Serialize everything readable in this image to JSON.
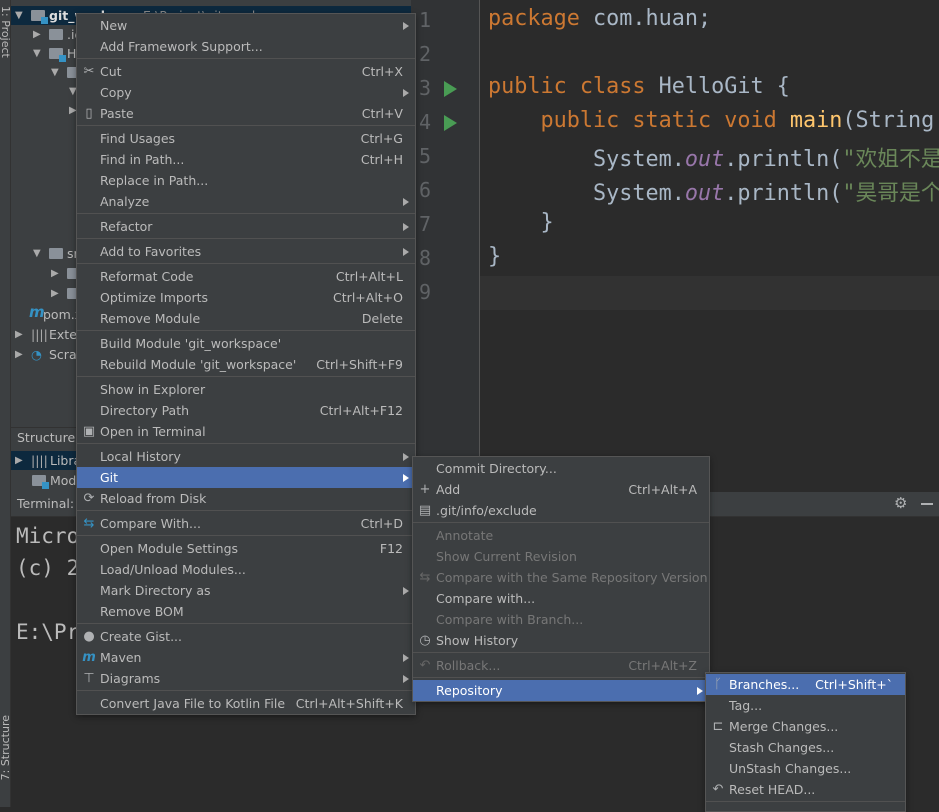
{
  "sidebar_tabs": {
    "project": "1: Project",
    "structure": "7: Structure"
  },
  "project_tree": [
    {
      "label": "git_workspace",
      "path": "E:\\Project\\git_workspace",
      "selected": true,
      "expanded": true,
      "icon": "module-folder-icon"
    },
    {
      "label": ".idea",
      "expanded": false,
      "icon": "folder-icon"
    },
    {
      "label": "HelloGit",
      "expanded": true,
      "icon": "module-folder-icon"
    },
    {
      "label": "",
      "expanded": true,
      "icon": "folder-icon"
    },
    {
      "label": "",
      "expanded": true,
      "icon": "none"
    },
    {
      "label": "",
      "expanded": false,
      "icon": "folder-icon"
    },
    {
      "label": "m",
      "expanded": null,
      "icon": "maven-icon"
    },
    {
      "label": "src",
      "expanded": true,
      "icon": "folder-icon"
    },
    {
      "label": "",
      "expanded": false,
      "icon": "folder-icon"
    },
    {
      "label": "",
      "expanded": false,
      "icon": "folder-icon"
    },
    {
      "label": "pom.xml",
      "expanded": null,
      "icon": "maven-icon"
    },
    {
      "label": "External Libraries",
      "expanded": false,
      "icon": "library-icon"
    },
    {
      "label": "Scratches and Consoles",
      "expanded": false,
      "icon": "scratches-icon"
    }
  ],
  "structure": {
    "title": "Structure",
    "items": [
      {
        "label": "Libraries",
        "icon": "library-icon",
        "selected": true
      },
      {
        "label": "Modules",
        "icon": "module-icon",
        "selected": false
      }
    ]
  },
  "editor": {
    "line_numbers": [
      "1",
      "2",
      "3",
      "4",
      "5",
      "6",
      "7",
      "8",
      "9"
    ],
    "lines": [
      [
        [
          "kw",
          "package "
        ],
        [
          "",
          "com.huan;"
        ]
      ],
      [],
      [
        [
          "kw",
          "public class "
        ],
        [
          "",
          "HelloGit {"
        ]
      ],
      [
        [
          "kw",
          "    public static void "
        ],
        [
          "fn",
          "main"
        ],
        [
          "",
          "(String["
        ]
      ],
      [
        [
          "",
          "        System."
        ],
        [
          "it",
          "out"
        ],
        [
          "",
          ".println("
        ],
        [
          "st",
          "\"欢姐不是"
        ]
      ],
      [
        [
          "",
          "        System."
        ],
        [
          "it",
          "out"
        ],
        [
          "",
          ".println("
        ],
        [
          "st",
          "\"昊哥是个"
        ]
      ],
      [
        [
          "",
          "    }"
        ]
      ],
      [
        [
          "",
          "}"
        ]
      ],
      []
    ]
  },
  "terminal": {
    "title": "Terminal:",
    "lines": [
      "Micro",
      "(c) 2",
      "",
      "E:\\Pr"
    ]
  },
  "context_menu": [
    {
      "label": "New",
      "submenu": true
    },
    {
      "label": "Add Framework Support..."
    },
    {
      "sep": true
    },
    {
      "label": "Cut",
      "shortcut": "Ctrl+X",
      "icon": "scissors-icon"
    },
    {
      "label": "Copy",
      "submenu": true
    },
    {
      "label": "Paste",
      "shortcut": "Ctrl+V",
      "icon": "paste-icon"
    },
    {
      "sep": true
    },
    {
      "label": "Find Usages",
      "shortcut": "Ctrl+G"
    },
    {
      "label": "Find in Path...",
      "shortcut": "Ctrl+H"
    },
    {
      "label": "Replace in Path..."
    },
    {
      "label": "Analyze",
      "submenu": true
    },
    {
      "sep": true
    },
    {
      "label": "Refactor",
      "submenu": true
    },
    {
      "sep": true
    },
    {
      "label": "Add to Favorites",
      "submenu": true
    },
    {
      "sep": true
    },
    {
      "label": "Reformat Code",
      "shortcut": "Ctrl+Alt+L"
    },
    {
      "label": "Optimize Imports",
      "shortcut": "Ctrl+Alt+O"
    },
    {
      "label": "Remove Module",
      "shortcut": "Delete"
    },
    {
      "sep": true
    },
    {
      "label": "Build Module 'git_workspace'"
    },
    {
      "label": "Rebuild Module 'git_workspace'",
      "shortcut": "Ctrl+Shift+F9"
    },
    {
      "sep": true
    },
    {
      "label": "Show in Explorer"
    },
    {
      "label": "Directory Path",
      "shortcut": "Ctrl+Alt+F12"
    },
    {
      "label": "Open in Terminal",
      "icon": "terminal-icon"
    },
    {
      "sep": true
    },
    {
      "label": "Local History",
      "submenu": true
    },
    {
      "label": "Git",
      "submenu": true,
      "selected": true
    },
    {
      "label": "Reload from Disk",
      "icon": "reload-icon"
    },
    {
      "sep": true
    },
    {
      "label": "Compare With...",
      "shortcut": "Ctrl+D",
      "icon": "compare-icon"
    },
    {
      "sep": true
    },
    {
      "label": "Open Module Settings",
      "shortcut": "F12"
    },
    {
      "label": "Load/Unload Modules..."
    },
    {
      "label": "Mark Directory as",
      "submenu": true
    },
    {
      "label": "Remove BOM"
    },
    {
      "sep": true
    },
    {
      "label": "Create Gist...",
      "icon": "github-icon"
    },
    {
      "label": "Maven",
      "submenu": true,
      "icon": "maven-icon"
    },
    {
      "label": "Diagrams",
      "submenu": true,
      "icon": "diagrams-icon"
    },
    {
      "sep": true
    },
    {
      "label": "Convert Java File to Kotlin File",
      "shortcut": "Ctrl+Alt+Shift+K"
    }
  ],
  "git_menu": [
    {
      "label": "Commit Directory..."
    },
    {
      "label": "Add",
      "shortcut": "Ctrl+Alt+A",
      "icon": "plus-icon"
    },
    {
      "label": ".git/info/exclude",
      "icon": "exclude-file-icon"
    },
    {
      "sep": true
    },
    {
      "label": "Annotate",
      "disabled": true
    },
    {
      "label": "Show Current Revision",
      "disabled": true
    },
    {
      "label": "Compare with the Same Repository Version",
      "disabled": true,
      "icon": "compare-icon"
    },
    {
      "label": "Compare with..."
    },
    {
      "label": "Compare with Branch...",
      "disabled": true
    },
    {
      "label": "Show History",
      "icon": "clock-icon"
    },
    {
      "sep": true
    },
    {
      "label": "Rollback...",
      "shortcut": "Ctrl+Alt+Z",
      "disabled": true,
      "icon": "rollback-icon"
    },
    {
      "sep": true
    },
    {
      "label": "Repository",
      "submenu": true,
      "selected": true
    }
  ],
  "repository_menu": [
    {
      "label": "Branches...",
      "shortcut": "Ctrl+Shift+`",
      "selected": true,
      "icon": "branch-icon"
    },
    {
      "label": "Tag..."
    },
    {
      "label": "Merge Changes...",
      "icon": "merge-icon"
    },
    {
      "label": "Stash Changes..."
    },
    {
      "label": "UnStash Changes..."
    },
    {
      "label": "Reset HEAD...",
      "icon": "reset-icon"
    },
    {
      "sep": true
    }
  ],
  "colors": {
    "menu_bg": "#3c3f41",
    "selection": "#4b6eaf",
    "keyword": "#cc7832",
    "string": "#6a8759",
    "run_icon": "#499c54"
  }
}
